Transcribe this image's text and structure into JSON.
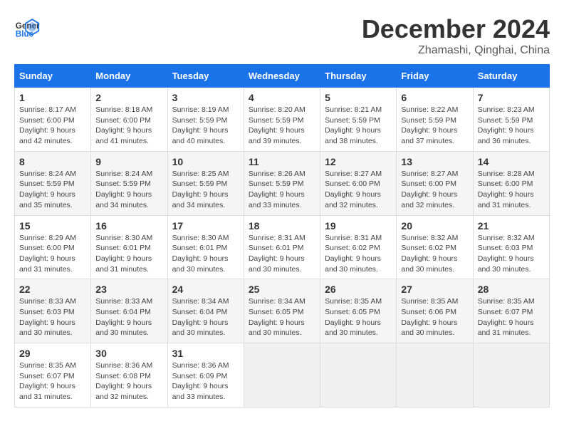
{
  "header": {
    "logo_line1": "General",
    "logo_line2": "Blue",
    "month": "December 2024",
    "location": "Zhamashi, Qinghai, China"
  },
  "weekdays": [
    "Sunday",
    "Monday",
    "Tuesday",
    "Wednesday",
    "Thursday",
    "Friday",
    "Saturday"
  ],
  "weeks": [
    [
      {
        "day": "1",
        "info": "Sunrise: 8:17 AM\nSunset: 6:00 PM\nDaylight: 9 hours\nand 42 minutes."
      },
      {
        "day": "2",
        "info": "Sunrise: 8:18 AM\nSunset: 6:00 PM\nDaylight: 9 hours\nand 41 minutes."
      },
      {
        "day": "3",
        "info": "Sunrise: 8:19 AM\nSunset: 5:59 PM\nDaylight: 9 hours\nand 40 minutes."
      },
      {
        "day": "4",
        "info": "Sunrise: 8:20 AM\nSunset: 5:59 PM\nDaylight: 9 hours\nand 39 minutes."
      },
      {
        "day": "5",
        "info": "Sunrise: 8:21 AM\nSunset: 5:59 PM\nDaylight: 9 hours\nand 38 minutes."
      },
      {
        "day": "6",
        "info": "Sunrise: 8:22 AM\nSunset: 5:59 PM\nDaylight: 9 hours\nand 37 minutes."
      },
      {
        "day": "7",
        "info": "Sunrise: 8:23 AM\nSunset: 5:59 PM\nDaylight: 9 hours\nand 36 minutes."
      }
    ],
    [
      {
        "day": "8",
        "info": "Sunrise: 8:24 AM\nSunset: 5:59 PM\nDaylight: 9 hours\nand 35 minutes."
      },
      {
        "day": "9",
        "info": "Sunrise: 8:24 AM\nSunset: 5:59 PM\nDaylight: 9 hours\nand 34 minutes."
      },
      {
        "day": "10",
        "info": "Sunrise: 8:25 AM\nSunset: 5:59 PM\nDaylight: 9 hours\nand 34 minutes."
      },
      {
        "day": "11",
        "info": "Sunrise: 8:26 AM\nSunset: 5:59 PM\nDaylight: 9 hours\nand 33 minutes."
      },
      {
        "day": "12",
        "info": "Sunrise: 8:27 AM\nSunset: 6:00 PM\nDaylight: 9 hours\nand 32 minutes."
      },
      {
        "day": "13",
        "info": "Sunrise: 8:27 AM\nSunset: 6:00 PM\nDaylight: 9 hours\nand 32 minutes."
      },
      {
        "day": "14",
        "info": "Sunrise: 8:28 AM\nSunset: 6:00 PM\nDaylight: 9 hours\nand 31 minutes."
      }
    ],
    [
      {
        "day": "15",
        "info": "Sunrise: 8:29 AM\nSunset: 6:00 PM\nDaylight: 9 hours\nand 31 minutes."
      },
      {
        "day": "16",
        "info": "Sunrise: 8:30 AM\nSunset: 6:01 PM\nDaylight: 9 hours\nand 31 minutes."
      },
      {
        "day": "17",
        "info": "Sunrise: 8:30 AM\nSunset: 6:01 PM\nDaylight: 9 hours\nand 30 minutes."
      },
      {
        "day": "18",
        "info": "Sunrise: 8:31 AM\nSunset: 6:01 PM\nDaylight: 9 hours\nand 30 minutes."
      },
      {
        "day": "19",
        "info": "Sunrise: 8:31 AM\nSunset: 6:02 PM\nDaylight: 9 hours\nand 30 minutes."
      },
      {
        "day": "20",
        "info": "Sunrise: 8:32 AM\nSunset: 6:02 PM\nDaylight: 9 hours\nand 30 minutes."
      },
      {
        "day": "21",
        "info": "Sunrise: 8:32 AM\nSunset: 6:03 PM\nDaylight: 9 hours\nand 30 minutes."
      }
    ],
    [
      {
        "day": "22",
        "info": "Sunrise: 8:33 AM\nSunset: 6:03 PM\nDaylight: 9 hours\nand 30 minutes."
      },
      {
        "day": "23",
        "info": "Sunrise: 8:33 AM\nSunset: 6:04 PM\nDaylight: 9 hours\nand 30 minutes."
      },
      {
        "day": "24",
        "info": "Sunrise: 8:34 AM\nSunset: 6:04 PM\nDaylight: 9 hours\nand 30 minutes."
      },
      {
        "day": "25",
        "info": "Sunrise: 8:34 AM\nSunset: 6:05 PM\nDaylight: 9 hours\nand 30 minutes."
      },
      {
        "day": "26",
        "info": "Sunrise: 8:35 AM\nSunset: 6:05 PM\nDaylight: 9 hours\nand 30 minutes."
      },
      {
        "day": "27",
        "info": "Sunrise: 8:35 AM\nSunset: 6:06 PM\nDaylight: 9 hours\nand 30 minutes."
      },
      {
        "day": "28",
        "info": "Sunrise: 8:35 AM\nSunset: 6:07 PM\nDaylight: 9 hours\nand 31 minutes."
      }
    ],
    [
      {
        "day": "29",
        "info": "Sunrise: 8:35 AM\nSunset: 6:07 PM\nDaylight: 9 hours\nand 31 minutes."
      },
      {
        "day": "30",
        "info": "Sunrise: 8:36 AM\nSunset: 6:08 PM\nDaylight: 9 hours\nand 32 minutes."
      },
      {
        "day": "31",
        "info": "Sunrise: 8:36 AM\nSunset: 6:09 PM\nDaylight: 9 hours\nand 33 minutes."
      },
      null,
      null,
      null,
      null
    ]
  ]
}
